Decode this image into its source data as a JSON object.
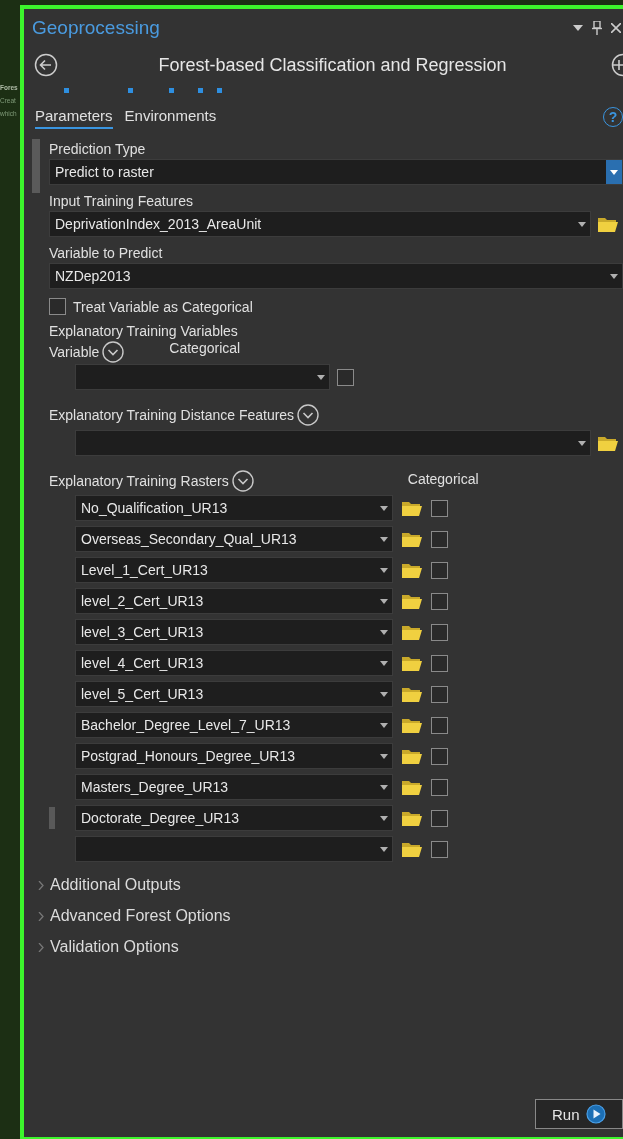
{
  "background_window": {
    "title": "Fores",
    "lines": [
      "Creat",
      "which"
    ]
  },
  "panel": {
    "title": "Geoprocessing"
  },
  "tool": {
    "title": "Forest-based Classification and Regression"
  },
  "tabs": [
    {
      "label": "Parameters",
      "selected": true
    },
    {
      "label": "Environments",
      "selected": false
    }
  ],
  "help": "?",
  "parameters": [
    {
      "kind": "combo",
      "label": "Prediction Type",
      "value": "Predict to raster",
      "browse": false,
      "focused": true
    },
    {
      "kind": "combo",
      "label": "Input Training Features",
      "value": "DeprivationIndex_2013_AreaUnit",
      "browse": true,
      "focused": false
    },
    {
      "kind": "combo",
      "label": "Variable to Predict",
      "value": "NZDep2013",
      "browse": false,
      "focused": false
    },
    {
      "kind": "checkbox",
      "label": "Treat Variable as Categorical",
      "checked": false
    },
    {
      "kind": "variables",
      "label": "Explanatory Training Variables",
      "column_1": "Variable",
      "column_2": "Categorical",
      "rows": [
        {
          "checked": false
        }
      ]
    },
    {
      "kind": "features",
      "label": "Explanatory Training Distance Features",
      "rows": [
        {
          "browse": true
        }
      ]
    },
    {
      "kind": "rasters",
      "label": "Explanatory Training Rasters",
      "column": "Categorical",
      "rows": [
        {
          "value": "No_Qualification_UR13",
          "checked": false,
          "selected": false
        },
        {
          "value": "Overseas_Secondary_Qual_UR13",
          "checked": false,
          "selected": false
        },
        {
          "value": "Level_1_Cert_UR13",
          "checked": false,
          "selected": false
        },
        {
          "value": "level_2_Cert_UR13",
          "checked": false,
          "selected": false
        },
        {
          "value": "level_3_Cert_UR13",
          "checked": false,
          "selected": false
        },
        {
          "value": "level_4_Cert_UR13",
          "checked": false,
          "selected": false
        },
        {
          "value": "level_5_Cert_UR13",
          "checked": false,
          "selected": false
        },
        {
          "value": "Bachelor_Degree_Level_7_UR13",
          "checked": false,
          "selected": false
        },
        {
          "value": "Postgrad_Honours_Degree_UR13",
          "checked": false,
          "selected": false
        },
        {
          "value": "Masters_Degree_UR13",
          "checked": false,
          "selected": false
        },
        {
          "value": "Doctorate_Degree_UR13",
          "checked": false,
          "selected": true
        },
        {
          "checked": false,
          "selected": false
        }
      ]
    }
  ],
  "sections": [
    {
      "label": "Additional Outputs",
      "expanded": false
    },
    {
      "label": "Advanced Forest Options",
      "expanded": false
    },
    {
      "label": "Validation Options",
      "expanded": false
    }
  ],
  "run_button": "Run"
}
